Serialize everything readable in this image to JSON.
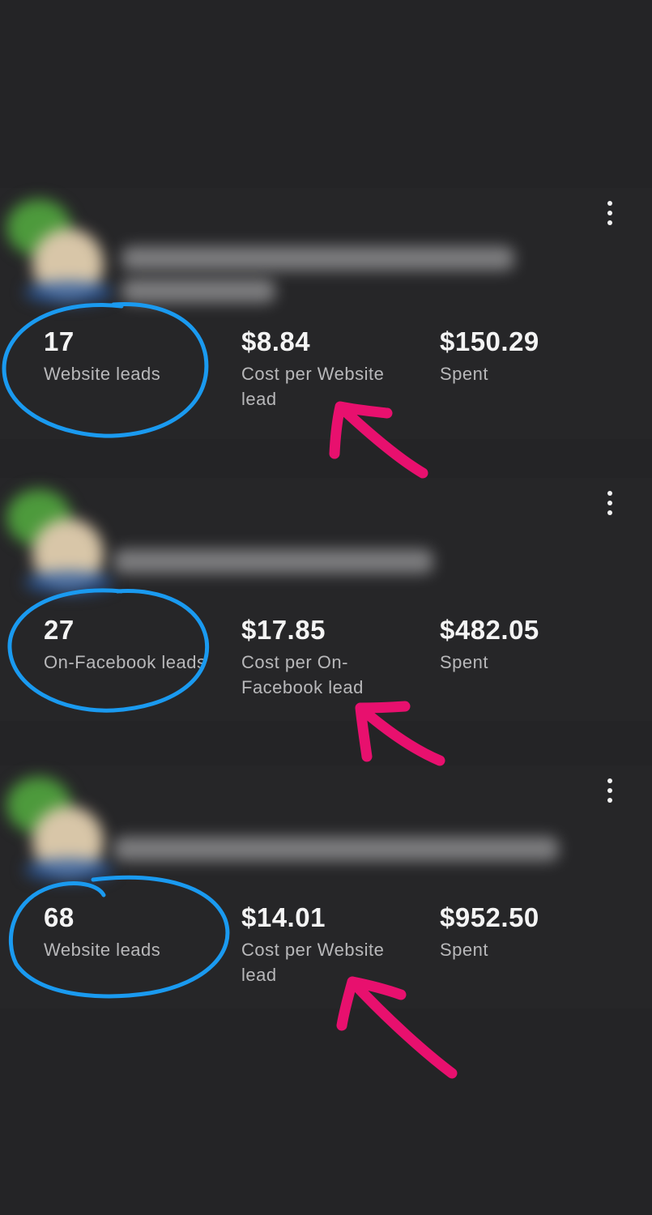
{
  "campaigns": [
    {
      "results_value": "17",
      "results_label": "Website leads",
      "cost_value": "$8.84",
      "cost_label": "Cost per Website lead",
      "spent_value": "$150.29",
      "spent_label": "Spent"
    },
    {
      "results_value": "27",
      "results_label": "On-Facebook leads",
      "cost_value": "$17.85",
      "cost_label": "Cost per On-Facebook lead",
      "spent_value": "$482.05",
      "spent_label": "Spent"
    },
    {
      "results_value": "68",
      "results_label": "Website leads",
      "cost_value": "$14.01",
      "cost_label": "Cost per Website lead",
      "spent_value": "$952.50",
      "spent_label": "Spent"
    }
  ],
  "colors": {
    "background": "#242426",
    "circle_annotation": "#1a9af0",
    "arrow_annotation": "#e8106e"
  }
}
